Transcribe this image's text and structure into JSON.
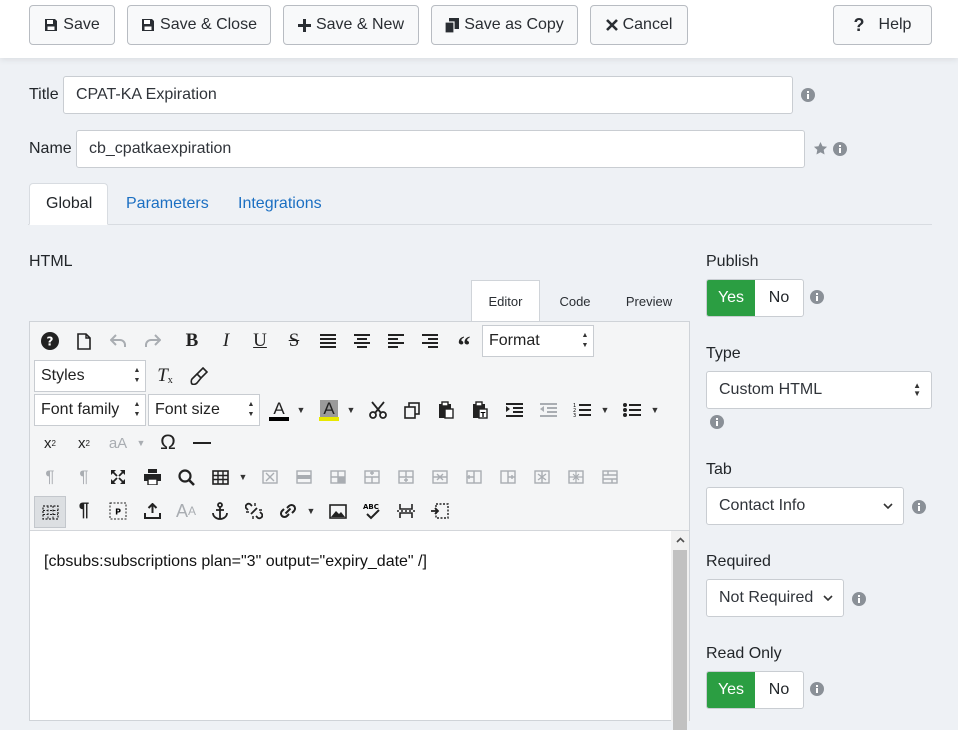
{
  "toolbar": {
    "save": "Save",
    "save_close": "Save & Close",
    "save_new": "Save & New",
    "save_copy": "Save as Copy",
    "cancel": "Cancel",
    "help": "Help"
  },
  "form": {
    "title_label": "Title",
    "title_value": "CPAT-KA Expiration",
    "name_label": "Name",
    "name_value": "cb_cpatkaexpiration"
  },
  "tabs": {
    "global": "Global",
    "parameters": "Parameters",
    "integrations": "Integrations"
  },
  "html_section": {
    "label": "HTML",
    "editor_tabs": [
      "Editor",
      "Code",
      "Preview"
    ],
    "format_select": "Format",
    "styles_select": "Styles",
    "font_family_select": "Font family",
    "font_size_select": "Font size",
    "content": "[cbsubs:subscriptions plan=\"3\" output=\"expiry_date\" /]"
  },
  "sidebar": {
    "publish_label": "Publish",
    "publish_yes": "Yes",
    "publish_no": "No",
    "type_label": "Type",
    "type_value": "Custom HTML",
    "tab_label": "Tab",
    "tab_value": "Contact Info",
    "required_label": "Required",
    "required_value": "Not Required",
    "readonly_label": "Read Only",
    "readonly_yes": "Yes",
    "readonly_no": "No"
  },
  "colors": {
    "accent_green": "#2b9e42",
    "link_blue": "#1b6fc2",
    "page_bg": "#eef1f5"
  }
}
